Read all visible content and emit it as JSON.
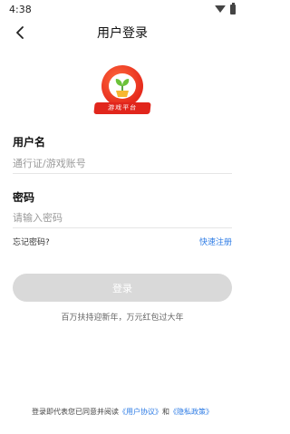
{
  "status_bar": {
    "time": "4:38"
  },
  "nav": {
    "title": "用户登录"
  },
  "logo": {
    "banner_text": "游戏平台"
  },
  "form": {
    "username_label": "用户名",
    "username_placeholder": "通行证/游戏账号",
    "password_label": "密码",
    "password_placeholder": "请输入密码"
  },
  "links": {
    "forgot_password": "忘记密码?",
    "quick_register": "快速注册"
  },
  "login_button_label": "登录",
  "promo_text": "百万扶持迎新年，万元红包过大年",
  "agreement": {
    "prefix": "登录即代表您已同意并阅读",
    "user_agreement": "《用户协议》",
    "and": "和",
    "privacy_policy": "《隐私政策》"
  },
  "colors": {
    "accent": "#2c7be5",
    "button_disabled": "#d9d9d9",
    "logo_red": "#e1261c"
  }
}
